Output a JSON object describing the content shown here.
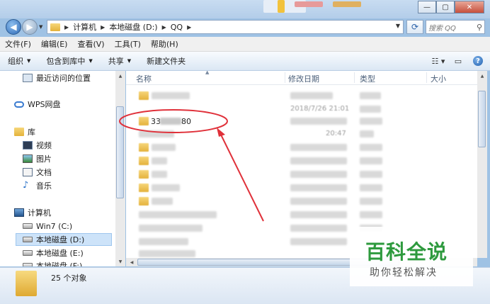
{
  "window": {
    "buttons": [
      "—",
      "▢",
      "✕"
    ]
  },
  "address": {
    "breadcrumbs": [
      "计算机",
      "本地磁盘 (D:)",
      "QQ"
    ],
    "search_placeholder": "搜索 QQ"
  },
  "menu": [
    "文件(F)",
    "编辑(E)",
    "查看(V)",
    "工具(T)",
    "帮助(H)"
  ],
  "toolbar": {
    "organize": "组织",
    "include_library": "包含到库中",
    "share": "共享",
    "new_folder": "新建文件夹"
  },
  "nav": {
    "recent": "最近访问的位置",
    "wps": "WPS网盘",
    "library": "库",
    "library_items": [
      "视频",
      "图片",
      "文档",
      "音乐"
    ],
    "computer": "计算机",
    "drives": [
      "Win7 (C:)",
      "本地磁盘 (D:)",
      "本地磁盘 (E:)",
      "本地磁盘 (F:)"
    ]
  },
  "columns": {
    "name": "名称",
    "modified": "修改日期",
    "type": "类型",
    "size": "大小"
  },
  "files": {
    "row1_date": "2018/7/26 21:01",
    "highlighted_name_start": "33",
    "highlighted_name_end": "80",
    "row3_time": "20:47"
  },
  "details": {
    "count": "25 个对象"
  },
  "watermark": {
    "title": "百科全说",
    "subtitle": "助你轻松解决"
  }
}
